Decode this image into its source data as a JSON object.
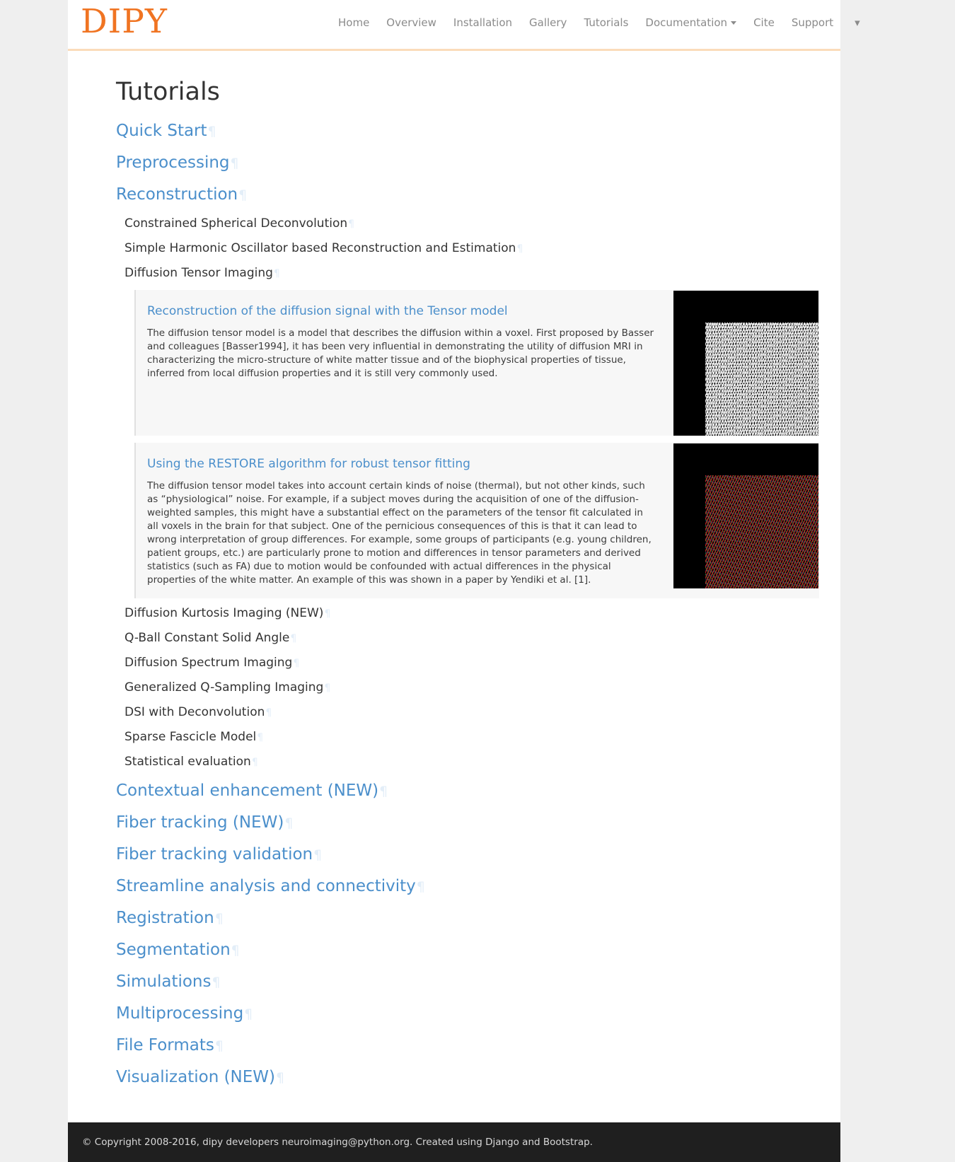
{
  "site": {
    "brand": "DIPY",
    "brand_color": "#f07422",
    "nav_border_color": "#fbdcba"
  },
  "nav": {
    "items": [
      {
        "label": "Home",
        "has_caret": false
      },
      {
        "label": "Overview",
        "has_caret": false
      },
      {
        "label": "Installation",
        "has_caret": false
      },
      {
        "label": "Gallery",
        "has_caret": false
      },
      {
        "label": "Tutorials",
        "has_caret": false
      },
      {
        "label": "Documentation",
        "has_caret": true
      },
      {
        "label": "Cite",
        "has_caret": false
      },
      {
        "label": "Support",
        "has_caret": false
      }
    ],
    "overflow_caret": "▾"
  },
  "page": {
    "title": "Tutorials",
    "anchor_mark": "¶",
    "anchor_color": "#e3eef8",
    "link_color": "#4b8fcb"
  },
  "sections": [
    {
      "label": "Quick Start"
    },
    {
      "label": "Preprocessing"
    },
    {
      "label": "Reconstruction"
    }
  ],
  "reconstruction_sub_top": [
    {
      "label": "Constrained Spherical Deconvolution"
    },
    {
      "label": "Simple Harmonic Oscillator based Reconstruction and Estimation"
    },
    {
      "label": "Diffusion Tensor Imaging"
    }
  ],
  "cards": [
    {
      "title": "Reconstruction of the diffusion signal with the Tensor model",
      "text": "The diffusion tensor model is a model that describes the diffusion within a voxel. First proposed by Basser and colleagues [Basser1994], it has been very influential in demonstrating the utility of diffusion MRI in characterizing the micro-structure of white matter tissue and of the biophysical properties of tissue, inferred from local diffusion properties and it is still very commonly used.",
      "thumb_style": "gray",
      "thumb_alt": "tensor-ellipsoid-field-grayscale"
    },
    {
      "title": "Using the RESTORE algorithm for robust tensor fitting",
      "text": "The diffusion tensor model takes into account certain kinds of noise (thermal), but not other kinds, such as “physiological” noise. For example, if a subject moves during the acquisition of one of the diffusion-weighted samples, this might have a substantial effect on the parameters of the tensor fit calculated in all voxels in the brain for that subject. One of the pernicious consequences of this is that it can lead to wrong interpretation of group differences. For example, some groups of participants (e.g. young children, patient groups, etc.) are particularly prone to motion and differences in tensor parameters and derived statistics (such as FA) due to motion would be confounded with actual differences in the physical properties of the white matter. An example of this was shown in a paper by Yendiki et al. [1].",
      "thumb_style": "color",
      "thumb_alt": "tensor-ellipsoid-field-color"
    }
  ],
  "reconstruction_sub_bottom": [
    {
      "label": "Diffusion Kurtosis Imaging (NEW)"
    },
    {
      "label": "Q-Ball Constant Solid Angle"
    },
    {
      "label": "Diffusion Spectrum Imaging"
    },
    {
      "label": "Generalized Q-Sampling Imaging"
    },
    {
      "label": "DSI with Deconvolution"
    },
    {
      "label": "Sparse Fascicle Model"
    },
    {
      "label": "Statistical evaluation"
    }
  ],
  "sections_rest": [
    {
      "label": "Contextual enhancement (NEW)"
    },
    {
      "label": "Fiber tracking (NEW)"
    },
    {
      "label": "Fiber tracking validation"
    },
    {
      "label": "Streamline analysis and connectivity"
    },
    {
      "label": "Registration"
    },
    {
      "label": "Segmentation"
    },
    {
      "label": "Simulations"
    },
    {
      "label": "Multiprocessing"
    },
    {
      "label": "File Formats"
    },
    {
      "label": "Visualization (NEW)"
    }
  ],
  "footer": {
    "text": "© Copyright 2008-2016, dipy developers neuroimaging@python.org. Created using Django and Bootstrap."
  }
}
